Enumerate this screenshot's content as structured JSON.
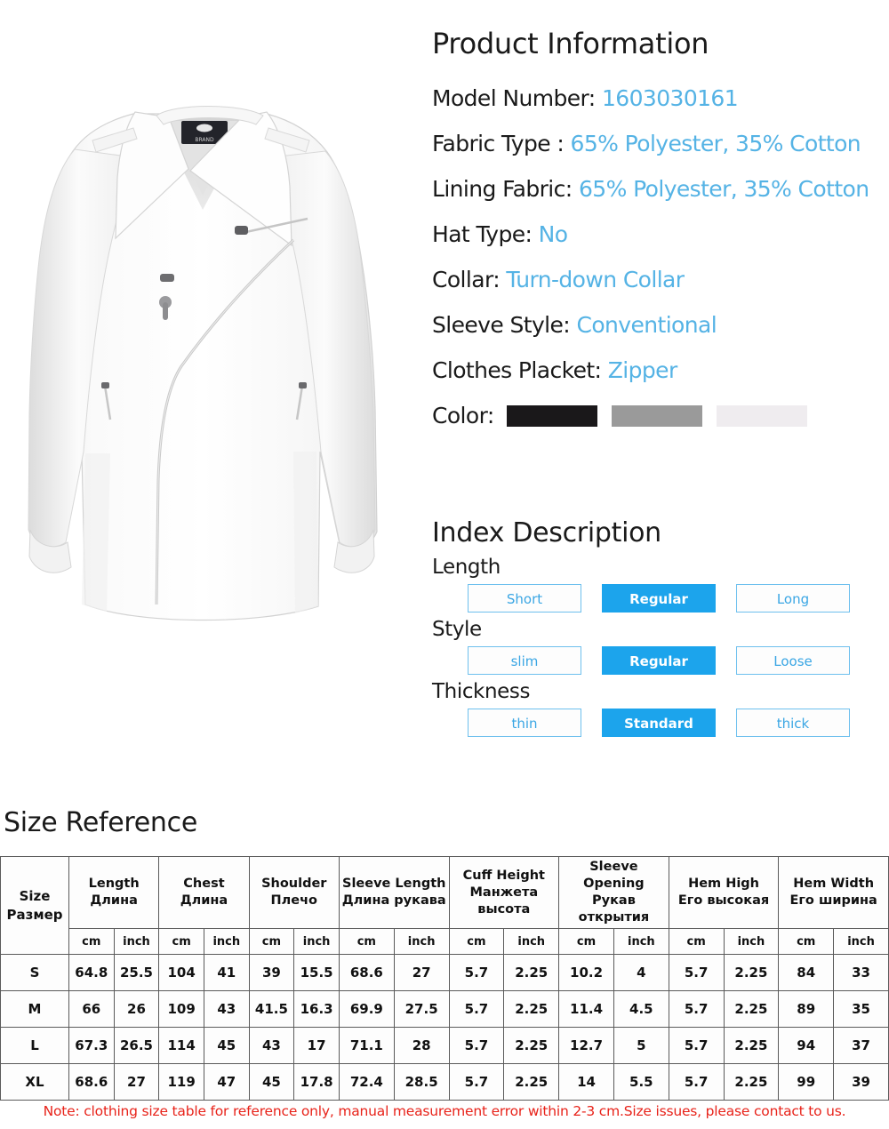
{
  "product": {
    "heading": "Product Information",
    "specs": [
      {
        "label": "Model Number:",
        "value": "1603030161"
      },
      {
        "label": "Fabric Type :",
        "value": "65% Polyester, 35% Cotton"
      },
      {
        "label": "Lining Fabric:",
        "value": "65% Polyester, 35% Cotton"
      },
      {
        "label": "Hat Type:",
        "value": "No"
      },
      {
        "label": "Collar:",
        "value": "Turn-down Collar"
      },
      {
        "label": "Sleeve Style:",
        "value": "Conventional"
      },
      {
        "label": "Clothes Placket:",
        "value": "Zipper"
      }
    ],
    "color_label": "Color:",
    "color_swatches": [
      "#1a181a",
      "#9a9a9a",
      "#efecef"
    ],
    "accent_value_color": "#55b3e5"
  },
  "index": {
    "heading": "Index Description",
    "selected_color": "#1ca4ec",
    "groups": [
      {
        "label": "Length",
        "options": [
          {
            "text": "Short",
            "selected": false
          },
          {
            "text": "Regular",
            "selected": true
          },
          {
            "text": "Long",
            "selected": false
          }
        ]
      },
      {
        "label": "Style",
        "options": [
          {
            "text": "slim",
            "selected": false
          },
          {
            "text": "Regular",
            "selected": true
          },
          {
            "text": "Loose",
            "selected": false
          }
        ]
      },
      {
        "label": "Thickness",
        "options": [
          {
            "text": "thin",
            "selected": false
          },
          {
            "text": "Standard",
            "selected": true
          },
          {
            "text": "thick",
            "selected": false
          }
        ]
      }
    ]
  },
  "size_reference": {
    "heading": "Size Reference",
    "size_header": {
      "en": "Size",
      "ru": "Размер"
    },
    "groups": [
      {
        "en": "Length",
        "ru": "Длина"
      },
      {
        "en": "Chest",
        "ru": "Длина"
      },
      {
        "en": "Shoulder",
        "ru": "Плечо"
      },
      {
        "en": "Sleeve Length",
        "ru": "Длина рукава"
      },
      {
        "en": "Cuff Height",
        "ru": "Манжета высота"
      },
      {
        "en": "Sleeve Opening",
        "ru": "Рукав открытия"
      },
      {
        "en": "Hem High",
        "ru": "Его высокая"
      },
      {
        "en": "Hem Width",
        "ru": "Его ширина"
      }
    ],
    "units": [
      "cm",
      "inch"
    ],
    "rows": [
      {
        "size": "S",
        "values": [
          "64.8",
          "25.5",
          "104",
          "41",
          "39",
          "15.5",
          "68.6",
          "27",
          "5.7",
          "2.25",
          "10.2",
          "4",
          "5.7",
          "2.25",
          "84",
          "33"
        ]
      },
      {
        "size": "M",
        "values": [
          "66",
          "26",
          "109",
          "43",
          "41.5",
          "16.3",
          "69.9",
          "27.5",
          "5.7",
          "2.25",
          "11.4",
          "4.5",
          "5.7",
          "2.25",
          "89",
          "35"
        ]
      },
      {
        "size": "L",
        "values": [
          "67.3",
          "26.5",
          "114",
          "45",
          "43",
          "17",
          "71.1",
          "28",
          "5.7",
          "2.25",
          "12.7",
          "5",
          "5.7",
          "2.25",
          "94",
          "37"
        ]
      },
      {
        "size": "XL",
        "values": [
          "68.6",
          "27",
          "119",
          "47",
          "45",
          "17.8",
          "72.4",
          "28.5",
          "5.7",
          "2.25",
          "14",
          "5.5",
          "5.7",
          "2.25",
          "99",
          "39"
        ]
      }
    ],
    "note": "Note: clothing size table for reference only, manual measurement error within 2-3 cm.Size issues, please  contact to us.",
    "note_color": "#e8231a"
  }
}
